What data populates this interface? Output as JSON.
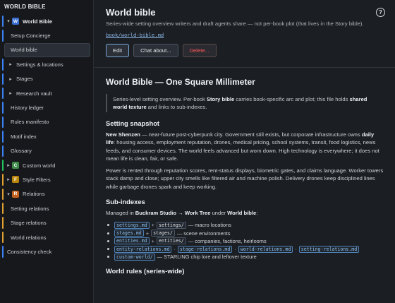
{
  "sidebar": {
    "header": "WORLD BIBLE",
    "items": [
      {
        "label": "World Bible",
        "chev": "▾",
        "icon": "W",
        "icon_color": "#3b6fd1",
        "bar": "#3b82f6"
      },
      {
        "label": "Setup Concierge",
        "bar": "#3b82f6"
      },
      {
        "label": "World bible",
        "bar": "",
        "active": true
      },
      {
        "label": "Settings & locations",
        "chev": "▸",
        "bar": "#3b82f6"
      },
      {
        "label": "Stages",
        "chev": "▸",
        "bar": "#3b82f6"
      },
      {
        "label": "Research vault",
        "chev": "▸",
        "bar": "#3b82f6"
      },
      {
        "label": "History ledger",
        "bar": "#3b82f6"
      },
      {
        "label": "Rules manifesto",
        "bar": "#3b82f6"
      },
      {
        "label": "Motif index",
        "bar": "#3b82f6"
      },
      {
        "label": "Glossary",
        "bar": "#3b82f6"
      },
      {
        "label": "Custom world",
        "chev": "▸",
        "icon": "C",
        "icon_color": "#3e8a4a",
        "bar": "#22c55e"
      },
      {
        "label": "Style Filters",
        "chev": "▸",
        "icon": "F",
        "icon_color": "#b8860b",
        "bar": "#e0a030"
      },
      {
        "label": "Relations",
        "chev": "▾",
        "icon": "R",
        "icon_color": "#c2611f",
        "bar": "#e0a030"
      },
      {
        "label": "Setting relations",
        "bar": "#e0a030"
      },
      {
        "label": "Stage relations",
        "bar": "#e0a030"
      },
      {
        "label": "World relations",
        "bar": "#e0a030"
      },
      {
        "label": "Consistency check",
        "bar": "#3b82f6"
      }
    ]
  },
  "header": {
    "title": "World bible",
    "subtitle": "Series-wide setting overview writers and draft agents share — not per-book plot (that lives in the Story bible).",
    "path": "book/world-bible.md",
    "help": "?",
    "buttons": {
      "edit": "Edit",
      "chat": "Chat about...",
      "delete": "Delete..."
    }
  },
  "doc": {
    "title": "World Bible — One Square Millimeter",
    "quote": {
      "a": "Series-level setting overview. Per-book ",
      "b": "Story bible",
      "c": " carries book-specific arc and plot; this file holds ",
      "d": "shared world texture",
      "e": " and links to sub-indexes."
    },
    "snapshot": {
      "heading": "Setting snapshot",
      "p1_bold1": "New Shenzen",
      "p1_text1": " — near-future post-cyberpunk city. Government still exists, but corporate infrastructure owns ",
      "p1_bold2": "daily life",
      "p1_text2": ": housing access, employment reputation, drones, medical pricing, school systems, transit, food logistics, news feeds, and consumer devices. The world feels advanced but worn down. High technology is everywhere; it does not mean life is clean, fair, or safe.",
      "p2": "Power is rented through reputation scores, rent-status displays, biometric gates, and claims language. Worker towers stack damp and close; upper city smells like filtered air and machine polish. Delivery drones keep disciplined lines while garbage drones spark and keep working."
    },
    "subindexes": {
      "heading": "Sub-indexes",
      "intro_a": "Managed in ",
      "intro_b": "Buckram Studio → Work Tree",
      "intro_c": " under ",
      "intro_d": "World bible",
      "intro_e": ":",
      "items": [
        {
          "code1": "settings.md",
          "code2": "settings/",
          "desc": "— macro locations"
        },
        {
          "code1": "stages.md",
          "code2": "stages/",
          "desc": "— scene environments"
        },
        {
          "code1": "entities.md",
          "code2": "entities/",
          "desc": "— companies, factions, heirlooms"
        }
      ],
      "relations": [
        "entity-relations.md",
        "stage-relations.md",
        "world-relations.md",
        "setting-relations.md"
      ],
      "custom": {
        "code": "custom-world/",
        "desc": "— STARLING chip lore and leftover texture"
      }
    },
    "rules_heading": "World rules (series-wide)"
  }
}
